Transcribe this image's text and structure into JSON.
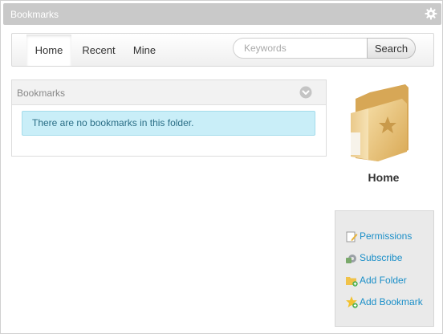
{
  "window": {
    "title": "Bookmarks"
  },
  "nav": {
    "tabs": [
      {
        "label": "Home",
        "active": true
      },
      {
        "label": "Recent",
        "active": false
      },
      {
        "label": "Mine",
        "active": false
      }
    ],
    "search": {
      "placeholder": "Keywords",
      "value": "",
      "button_label": "Search"
    }
  },
  "panel": {
    "title": "Bookmarks",
    "toggle_icon": "chevron-down-circle-icon",
    "empty_message": "There are no bookmarks in this folder."
  },
  "folder": {
    "name": "Home",
    "icon": "folder-star-icon"
  },
  "actions": [
    {
      "label": "Permissions",
      "icon": "permissions-icon"
    },
    {
      "label": "Subscribe",
      "icon": "subscribe-icon"
    },
    {
      "label": "Add Folder",
      "icon": "add-folder-icon"
    },
    {
      "label": "Add Bookmark",
      "icon": "add-bookmark-icon"
    }
  ],
  "colors": {
    "link": "#1b8fc8",
    "alert_bg": "#c9eef8",
    "titlebar": "#c9c9c9",
    "folder": "#e8c27a"
  }
}
